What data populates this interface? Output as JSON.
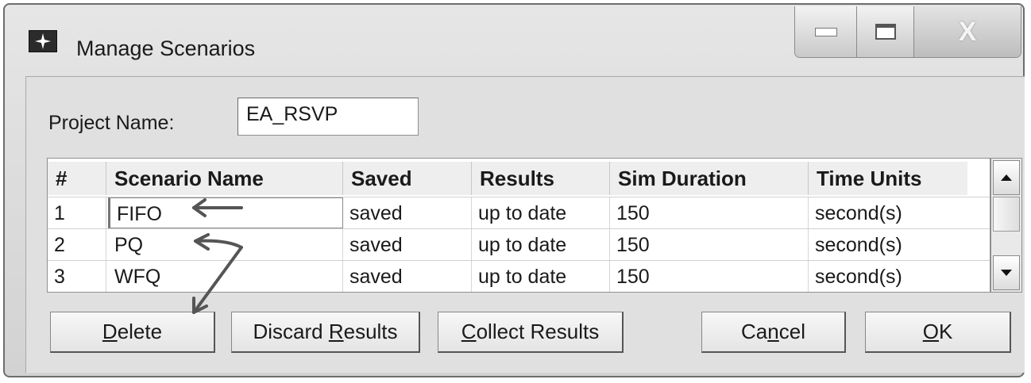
{
  "window": {
    "title": "Manage Scenarios",
    "close_glyph": "X"
  },
  "project": {
    "label": "Project Name:",
    "value": "EA_RSVP"
  },
  "table": {
    "headers": [
      "#",
      "Scenario Name",
      "Saved",
      "Results",
      "Sim Duration",
      "Time Units"
    ],
    "rows": [
      {
        "num": "1",
        "name": "FIFO",
        "saved": "saved",
        "results": "up to date",
        "duration": "150",
        "units": "second(s)"
      },
      {
        "num": "2",
        "name": "PQ",
        "saved": "saved",
        "results": "up to date",
        "duration": "150",
        "units": "second(s)"
      },
      {
        "num": "3",
        "name": "WFQ",
        "saved": "saved",
        "results": "up to date",
        "duration": "150",
        "units": "second(s)"
      }
    ]
  },
  "buttons": {
    "delete": {
      "pre": "",
      "mnemonic": "D",
      "post": "elete"
    },
    "discard": {
      "pre": "Discard ",
      "mnemonic": "R",
      "post": "esults"
    },
    "collect": {
      "pre": "",
      "mnemonic": "C",
      "post": "ollect Results"
    },
    "cancel": {
      "pre": "Ca",
      "mnemonic": "n",
      "post": "cel"
    },
    "ok": {
      "pre": "",
      "mnemonic": "O",
      "post": "K"
    }
  },
  "icons": {
    "app": "app-star-icon",
    "minimize": "minimize-icon",
    "maximize": "maximize-icon",
    "close": "close-icon",
    "scroll_up": "scroll-up-arrow-icon",
    "scroll_down": "scroll-down-arrow-icon"
  }
}
